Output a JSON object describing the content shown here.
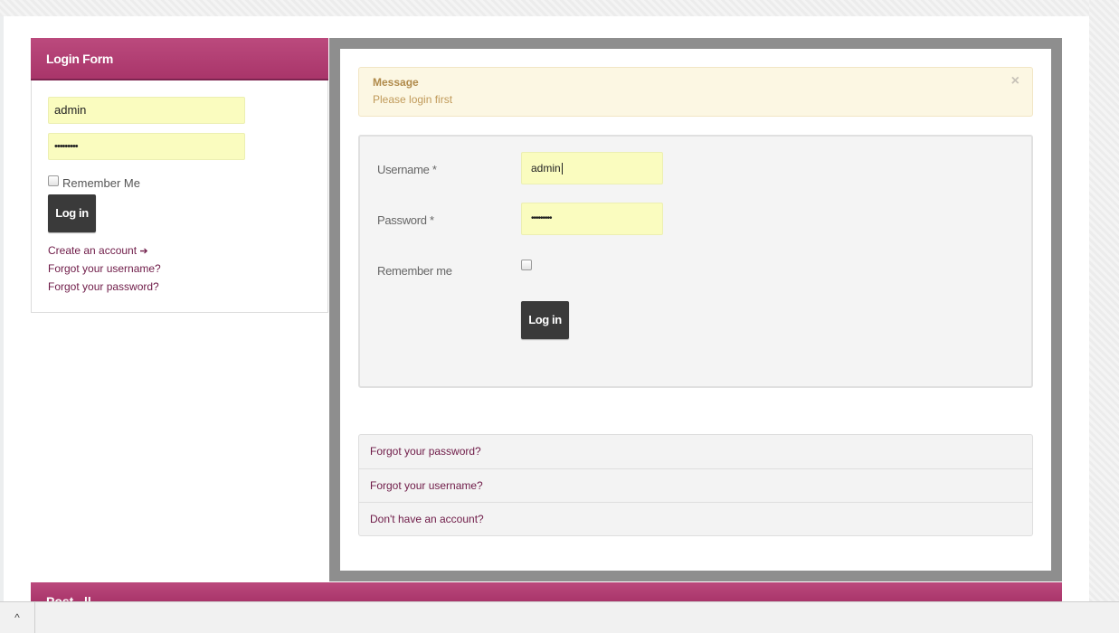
{
  "sidebar_login": {
    "title": "Login Form",
    "username_value": "admin",
    "password_value": "•••••••••",
    "remember_label": "Remember Me",
    "login_button": "Log in",
    "create_account": "Create an account",
    "create_account_arrow": "➔",
    "forgot_username": "Forgot your username?",
    "forgot_password": "Forgot your password?"
  },
  "message": {
    "heading": "Message",
    "text": "Please login first",
    "close": "×"
  },
  "main_login": {
    "username_label": "Username *",
    "username_value": "admin",
    "password_label": "Password *",
    "password_value": "•••••••••",
    "remember_label": "Remember me",
    "login_button": "Log in"
  },
  "help_links": [
    "Forgot your password?",
    "Forgot your username?",
    "Don't have an account?"
  ],
  "bottom_module": {
    "title": "Post...ll"
  },
  "statusbar": {
    "chevron": "^"
  },
  "colors": {
    "accent": "#b03d71",
    "link": "#6e1a47",
    "input_bg": "#fafcbf",
    "button": "#3a3a3a"
  }
}
